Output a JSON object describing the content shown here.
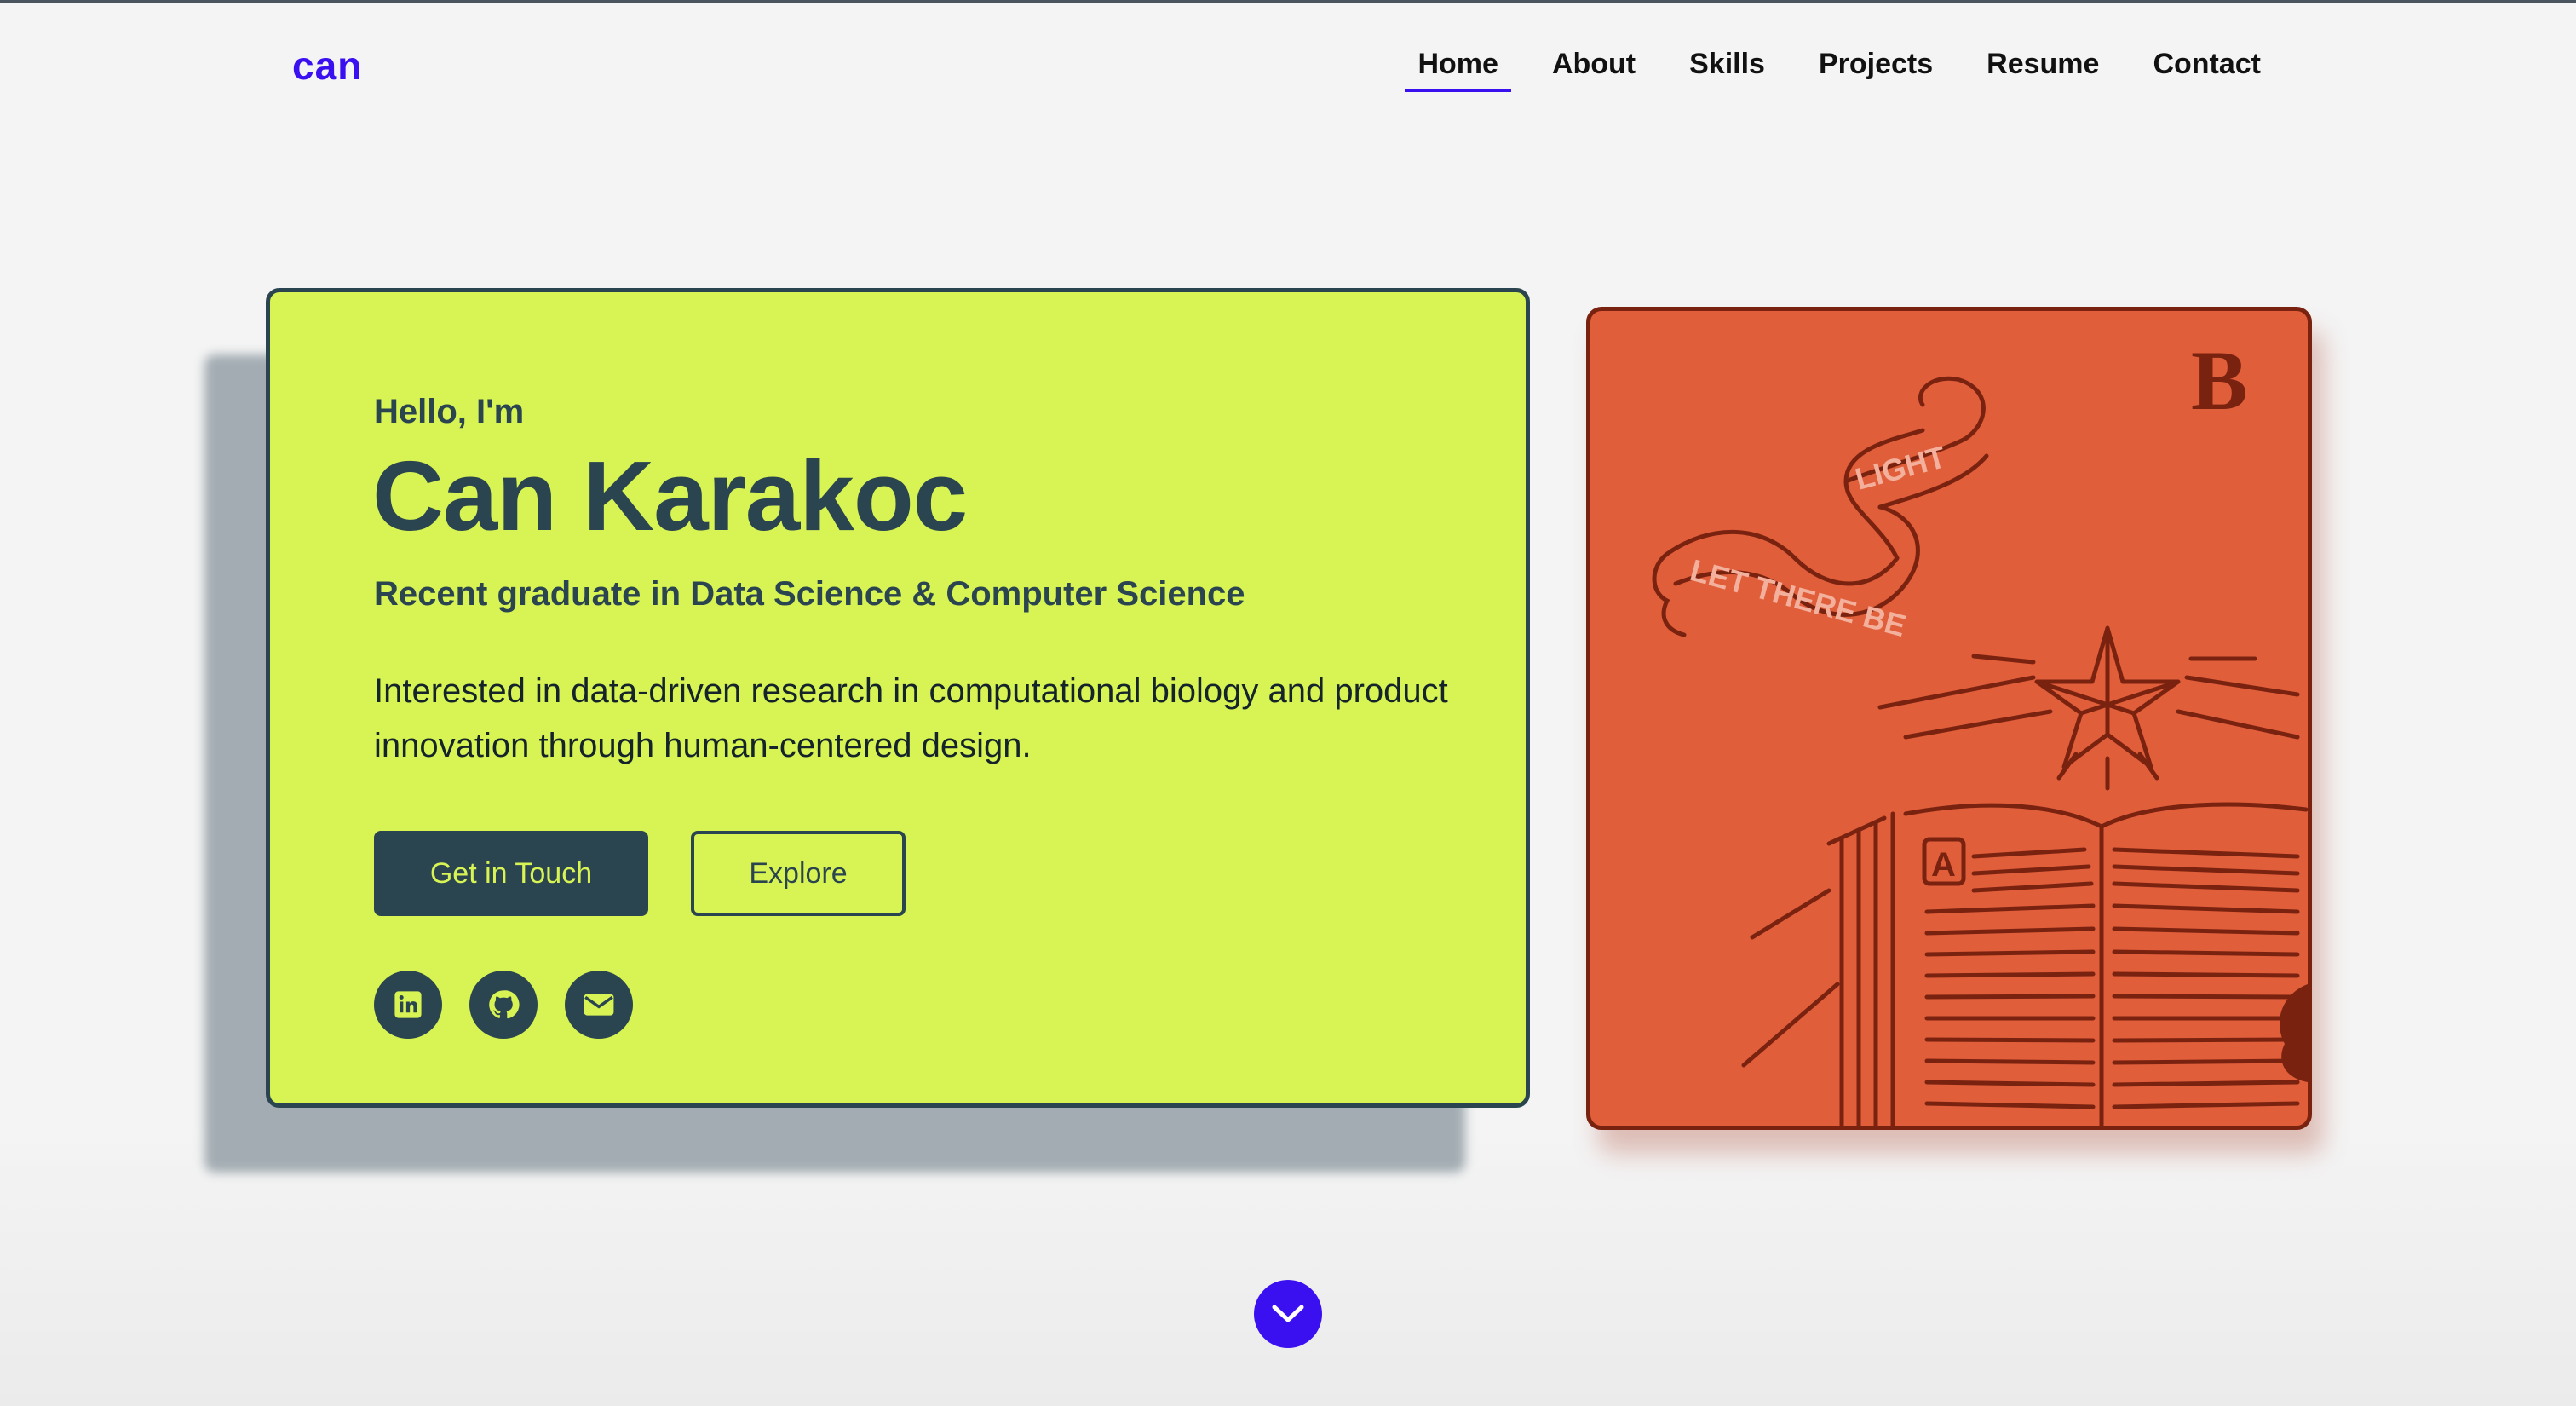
{
  "header": {
    "logo": "can",
    "nav": [
      {
        "label": "Home",
        "active": true
      },
      {
        "label": "About",
        "active": false
      },
      {
        "label": "Skills",
        "active": false
      },
      {
        "label": "Projects",
        "active": false
      },
      {
        "label": "Resume",
        "active": false
      },
      {
        "label": "Contact",
        "active": false
      }
    ]
  },
  "hero": {
    "greeting": "Hello, I'm",
    "name": "Can Karakoc",
    "subtitle": "Recent graduate in Data Science & Computer Science",
    "bio": "Interested in data-driven research in computational biology and product innovation through human-centered design.",
    "primary_button": "Get in Touch",
    "secondary_button": "Explore",
    "socials": [
      {
        "icon": "linkedin-icon"
      },
      {
        "icon": "github-icon"
      },
      {
        "icon": "email-icon"
      }
    ]
  },
  "illustration": {
    "banner_text_1": "LET THERE BE",
    "banner_text_2": "LIGHT",
    "corner_letter": "B",
    "page_letter": "A"
  },
  "scroll": {
    "icon": "chevron-down-icon"
  },
  "colors": {
    "accent": "#3b10f0",
    "hero_bg": "#d8f354",
    "hero_text": "#2a4550",
    "art_bg": "#e05e3a",
    "art_line": "#7a2210"
  }
}
